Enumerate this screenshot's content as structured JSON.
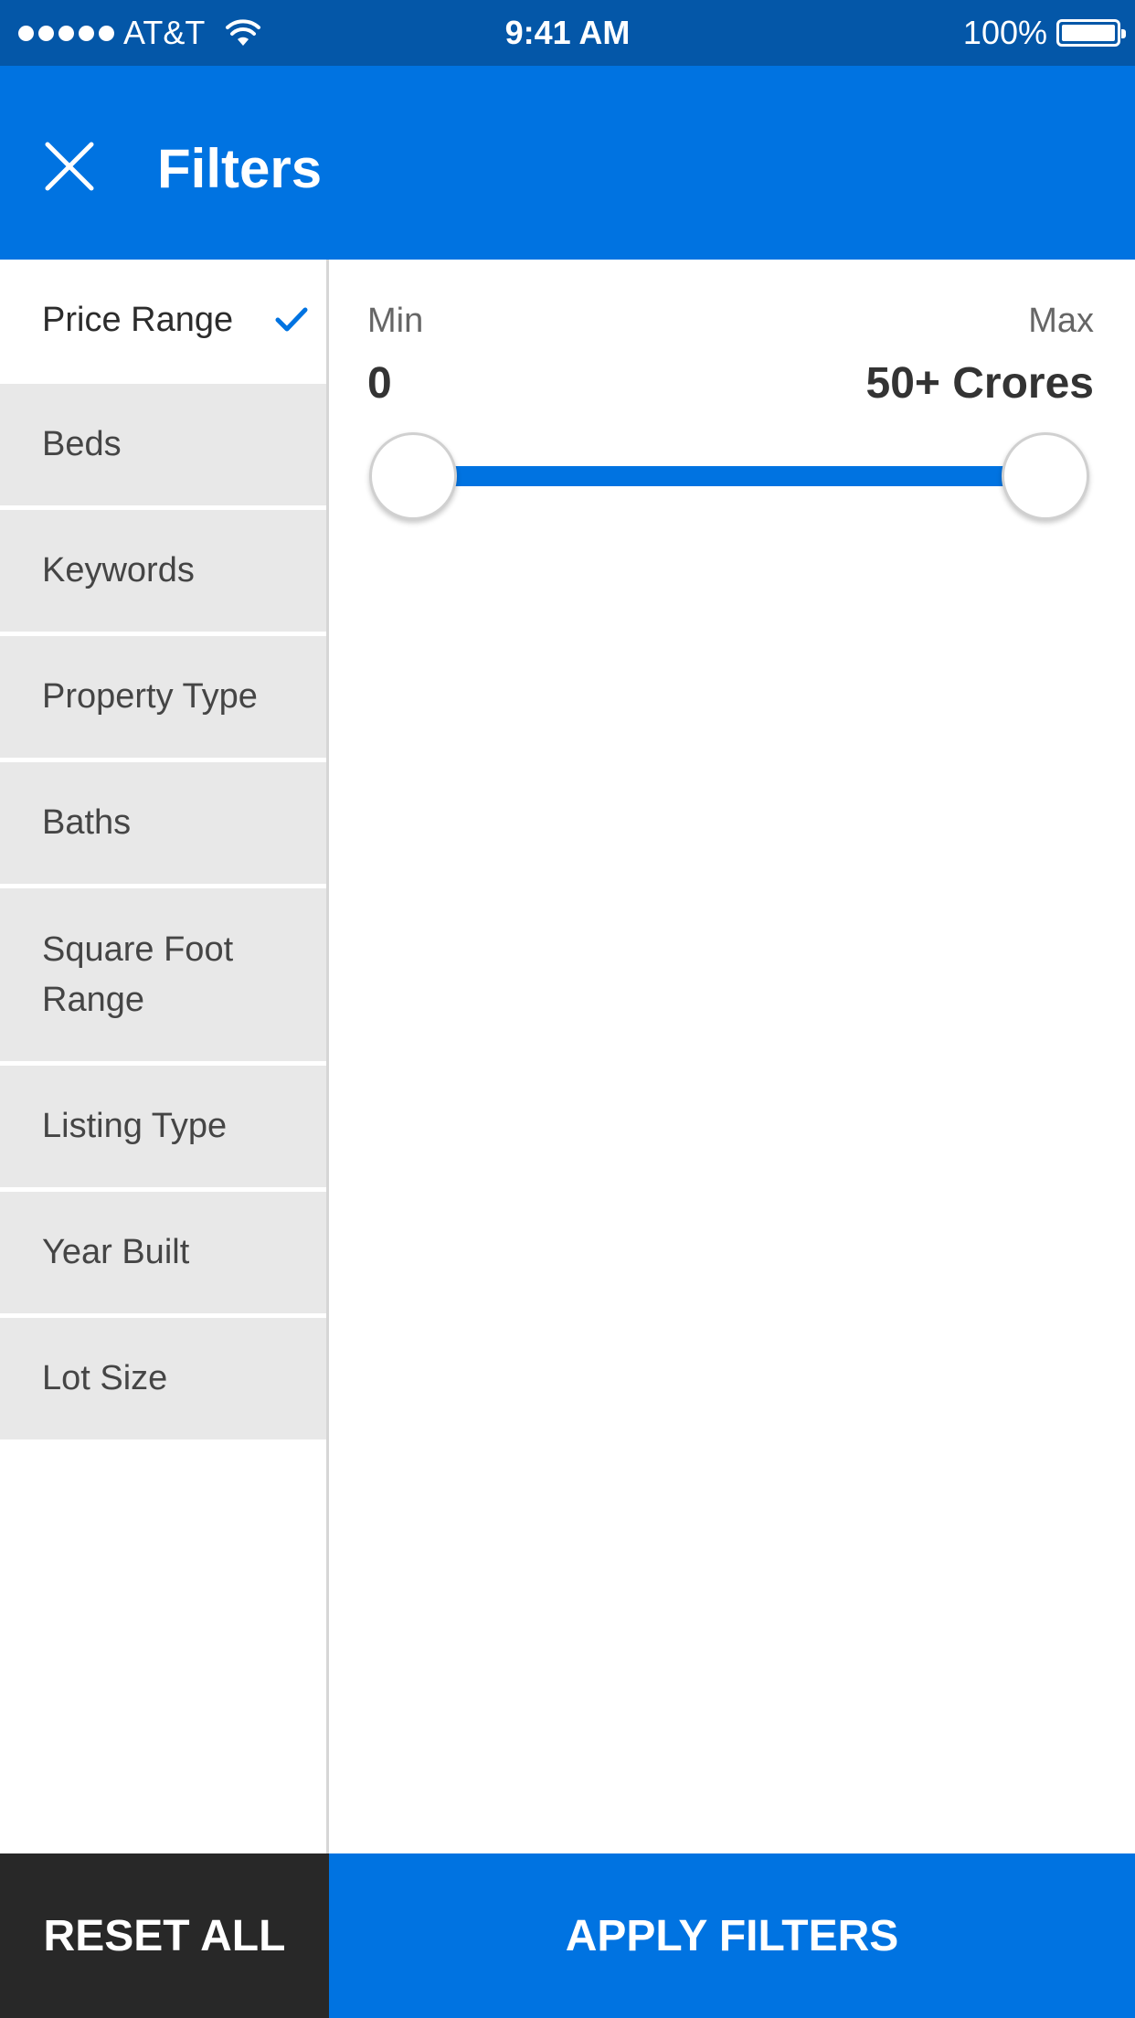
{
  "status_bar": {
    "carrier": "AT&T",
    "time": "9:41 AM",
    "battery": "100%"
  },
  "header": {
    "title": "Filters",
    "close_icon": "close-icon"
  },
  "sidebar": {
    "items": [
      {
        "label": "Price Range",
        "active": true,
        "checked": true
      },
      {
        "label": "Beds"
      },
      {
        "label": "Keywords"
      },
      {
        "label": "Property Type"
      },
      {
        "label": "Baths"
      },
      {
        "label": "Square Foot Range"
      },
      {
        "label": "Listing Type"
      },
      {
        "label": "Year Built"
      },
      {
        "label": "Lot Size"
      }
    ]
  },
  "price_range": {
    "min_label": "Min",
    "max_label": "Max",
    "min_value": "0",
    "max_value": "50+ Crores",
    "slider_min_fraction": 0,
    "slider_max_fraction": 1
  },
  "footer": {
    "reset_label": "RESET ALL",
    "apply_label": "APPLY FILTERS"
  },
  "colors": {
    "accent": "#0073e1",
    "status_bar": "#0457a8",
    "dark_button": "#282828",
    "sidebar_inactive": "#e8e8e8"
  }
}
